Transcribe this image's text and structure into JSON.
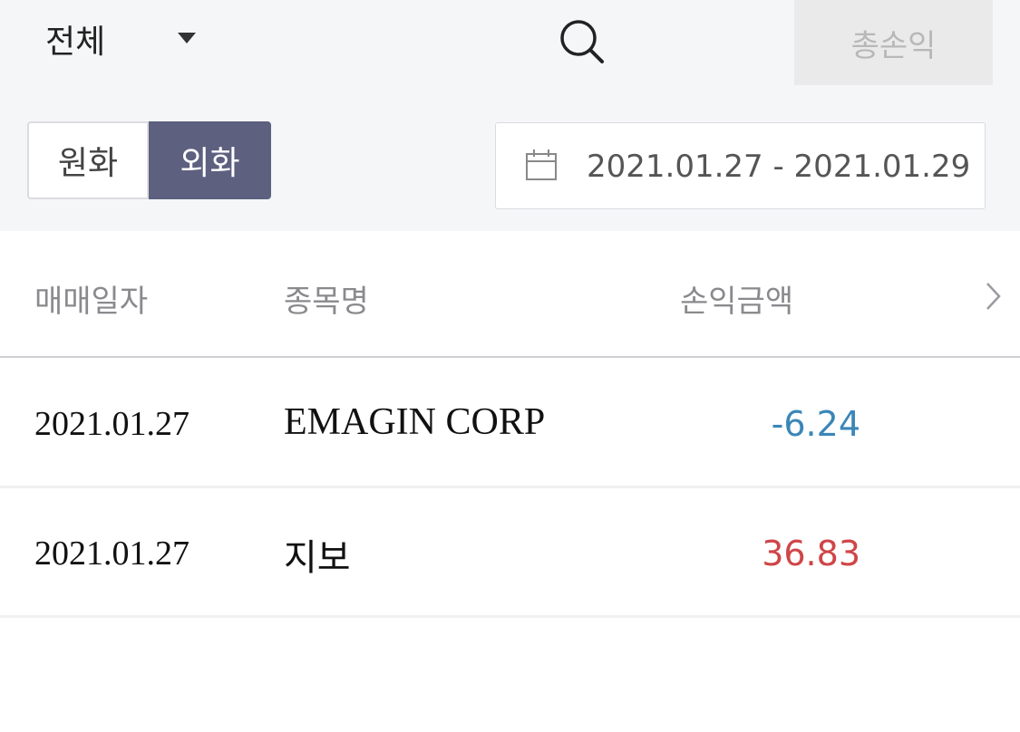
{
  "filter": {
    "label": "전체",
    "icon": "caret-down-icon"
  },
  "search": {
    "icon": "search-icon"
  },
  "total_pnl_button": {
    "label": "총손익"
  },
  "currency": {
    "options": [
      "원화",
      "외화"
    ],
    "selected": "외화"
  },
  "date_range": {
    "icon": "calendar-icon",
    "value": "2021.01.27 - 2021.01.29"
  },
  "table": {
    "columns": [
      "매매일자",
      "종목명",
      "손익금액"
    ],
    "more_icon": "chevron-right-icon",
    "rows": [
      {
        "date": "2021.01.27",
        "name": "EMAGIN CORP",
        "pnl": "-6.24"
      },
      {
        "date": "2021.01.27",
        "name": "지보",
        "pnl": "36.83"
      }
    ]
  },
  "colors": {
    "panel_bg": "#f5f6f8",
    "selected_toggle": "#5d607f",
    "loss": "#3a86b8",
    "gain": "#cf4548"
  }
}
